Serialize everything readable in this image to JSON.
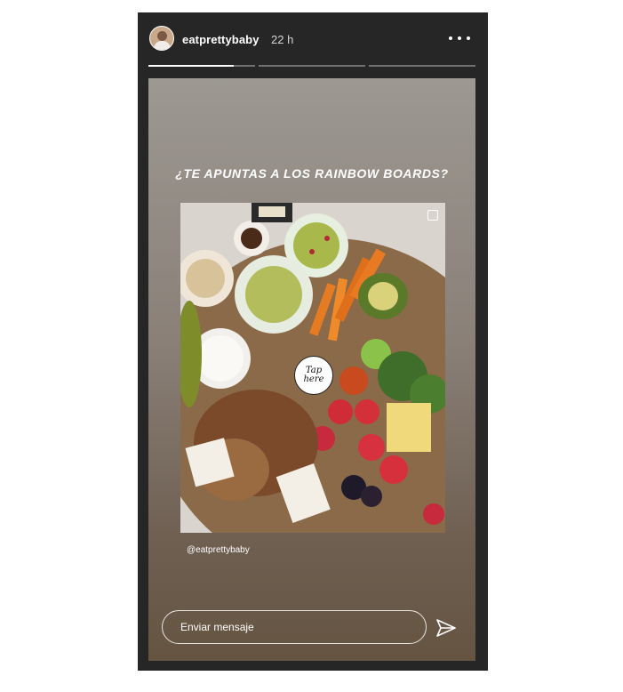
{
  "header": {
    "username": "eatprettybaby",
    "time": "22 h",
    "more_icon": "more-horizontal-icon",
    "progress": [
      1,
      0,
      0
    ]
  },
  "story": {
    "headline": "¿TE APUNTAS A LOS RAINBOW BOARDS?",
    "sticker_line1": "Tap",
    "sticker_line2": "here",
    "credit": "@eatprettybaby"
  },
  "reply": {
    "placeholder": "Enviar mensaje",
    "send_icon": "paper-plane-icon"
  },
  "colors": {
    "frame": "#262626",
    "story_top": "#9c9892",
    "story_bottom": "#655441",
    "text": "#ffffff"
  }
}
